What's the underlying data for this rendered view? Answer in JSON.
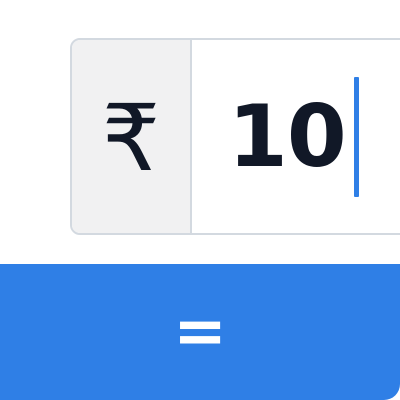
{
  "amount": {
    "currency_symbol": "₹",
    "value": "10"
  },
  "calculate": {
    "label": "="
  },
  "colors": {
    "accent": "#2f7fe6",
    "prefix_background": "#f1f1f2",
    "border": "#d3d9e0",
    "text": "#111827"
  }
}
